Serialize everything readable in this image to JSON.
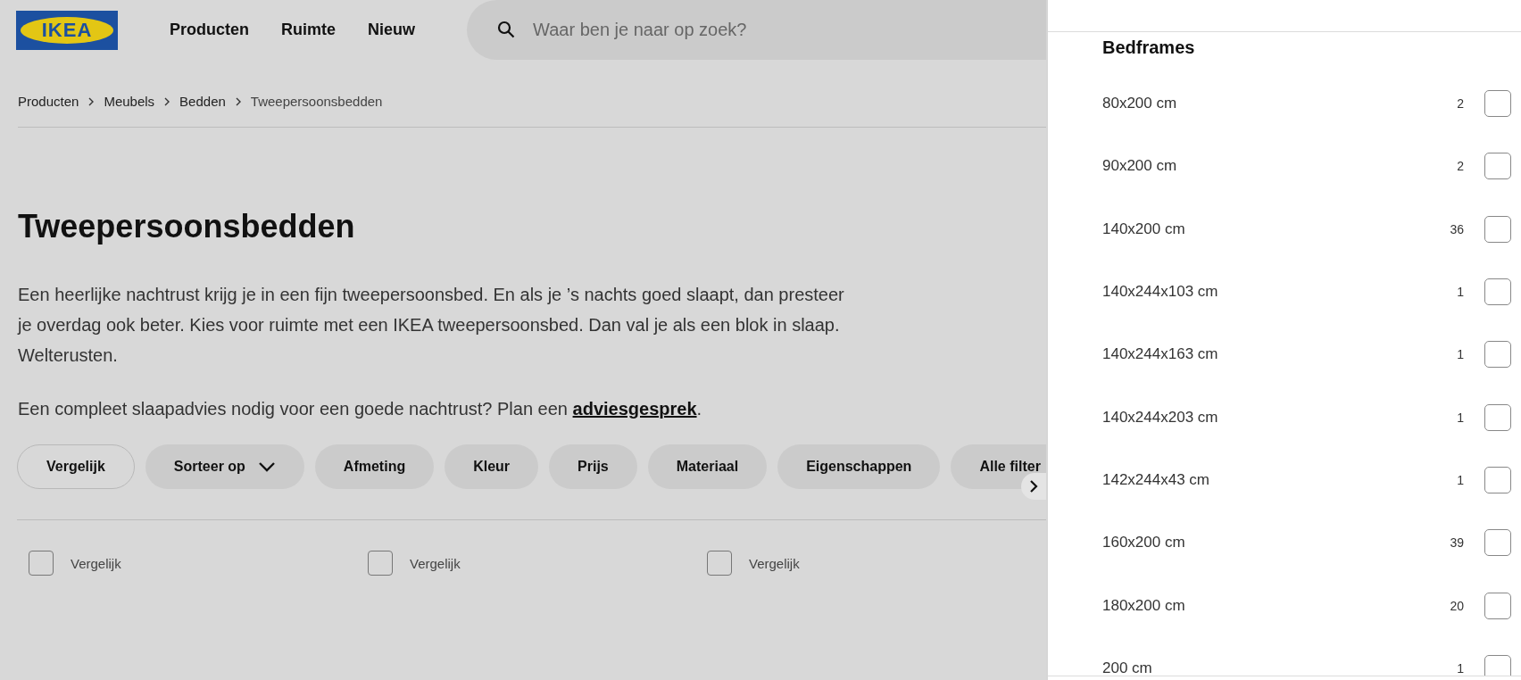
{
  "logo": {
    "text": "IKEA"
  },
  "nav": [
    "Producten",
    "Ruimte",
    "Nieuw"
  ],
  "search": {
    "placeholder": "Waar ben je naar op zoek?"
  },
  "breadcrumb": [
    "Producten",
    "Meubels",
    "Bedden",
    "Tweepersoonsbedden"
  ],
  "title": "Tweepersoonsbedden",
  "intro": "Een heerlijke nachtrust krijg je in een fijn tweepersoonsbed. En als je ’s nachts goed slaapt, dan presteer je overdag ook beter. Kies voor ruimte met een IKEA tweepersoonsbed. Dan val je als een blok in slaap. Welterusten.",
  "advice": {
    "text": "Een compleet slaapadvies nodig voor een goede nachtrust? Plan een ",
    "link": "adviesgesprek",
    "after": "."
  },
  "filters": [
    {
      "label": "Vergelijk",
      "kind": "outline"
    },
    {
      "label": "Sorteer op",
      "kind": "dropdown"
    },
    {
      "label": "Afmeting",
      "kind": "plain"
    },
    {
      "label": "Kleur",
      "kind": "plain"
    },
    {
      "label": "Prijs",
      "kind": "plain"
    },
    {
      "label": "Materiaal",
      "kind": "plain"
    },
    {
      "label": "Eigenschappen",
      "kind": "plain"
    },
    {
      "label": "Alle filter",
      "kind": "plain"
    }
  ],
  "compare": [
    {
      "label": "Vergelijk",
      "checked": false
    },
    {
      "label": "Vergelijk",
      "checked": false
    },
    {
      "label": "Vergelijk",
      "checked": false
    }
  ],
  "panel": {
    "heading": "Bedframes",
    "options": [
      {
        "label": "80x200 cm",
        "count": "2",
        "checked": false
      },
      {
        "label": "90x200 cm",
        "count": "2",
        "checked": false
      },
      {
        "label": "140x200 cm",
        "count": "36",
        "checked": false
      },
      {
        "label": "140x244x103 cm",
        "count": "1",
        "checked": false
      },
      {
        "label": "140x244x163 cm",
        "count": "1",
        "checked": false
      },
      {
        "label": "140x244x203 cm",
        "count": "1",
        "checked": false
      },
      {
        "label": "142x244x43 cm",
        "count": "1",
        "checked": false
      },
      {
        "label": "160x200 cm",
        "count": "39",
        "checked": false
      },
      {
        "label": "180x200 cm",
        "count": "20",
        "checked": false
      },
      {
        "label": "200 cm",
        "count": "1",
        "checked": false
      }
    ]
  }
}
